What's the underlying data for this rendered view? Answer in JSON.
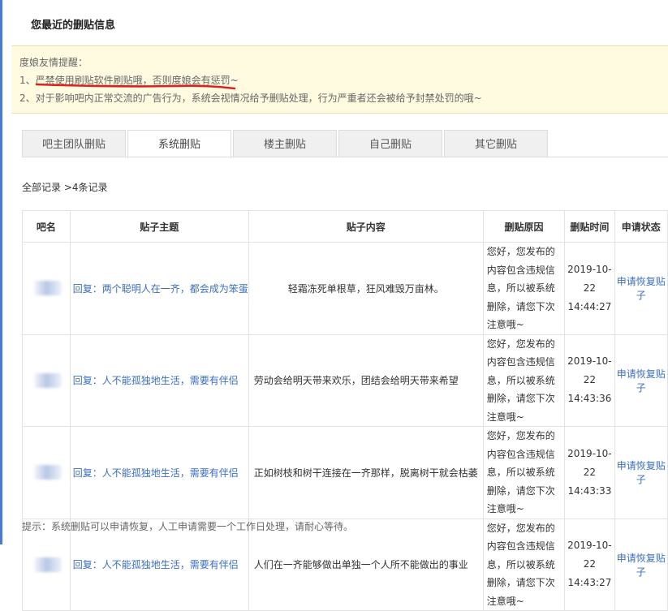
{
  "page": {
    "title": "您最近的删贴信息"
  },
  "notice": {
    "title": "度娘友情提醒：",
    "line1_prefix": "1、",
    "line1_warning": "严禁使用刷贴软件刷贴哦，否则度娘会有惩罚~",
    "line2": "2、对于影响吧内正常交流的广告行为，系统会视情况给予删贴处理，行为严重者还会被给予封禁处罚的哦~",
    "underline_color": "#e02020"
  },
  "tabs": [
    {
      "label": "吧主团队删贴",
      "active": false
    },
    {
      "label": "系统删贴",
      "active": true
    },
    {
      "label": "楼主删贴",
      "active": false
    },
    {
      "label": "自己删贴",
      "active": false
    },
    {
      "label": "其它删贴",
      "active": false
    }
  ],
  "summary": {
    "text": "全部记录 >4条记录"
  },
  "table": {
    "headers": {
      "name": "吧名",
      "topic": "贴子主题",
      "content": "贴子内容",
      "reason": "删贴原因",
      "time": "删贴时间",
      "status": "申请状态"
    },
    "rows": [
      {
        "topic": "回复：两个聪明人在一齐，都会成为笨蛋",
        "content": "轻霜冻死单根草，狂风难毁万亩林。",
        "reason": "您好，您发布的内容包含违规信息，所以被系统删除，请您下次注意哦~",
        "date": "2019-10-22",
        "clock": "14:44:27",
        "action": "申请恢复贴子"
      },
      {
        "topic": "回复：人不能孤独地生活，需要有伴侣",
        "content": "劳动会给明天带来欢乐，团结会给明天带来希望",
        "reason": "您好，您发布的内容包含违规信息，所以被系统删除，请您下次注意哦~",
        "date": "2019-10-22",
        "clock": "14:43:36",
        "action": "申请恢复贴子"
      },
      {
        "topic": "回复：人不能孤独地生活，需要有伴侣",
        "content": "正如树枝和树干连接在一齐那样，脱离树干就会枯萎",
        "reason": "您好，您发布的内容包含违规信息，所以被系统删除，请您下次注意哦~",
        "date": "2019-10-22",
        "clock": "14:43:33",
        "action": "申请恢复贴子"
      },
      {
        "topic": "回复：人不能孤独地生活，需要有伴侣",
        "content": "人们在一齐能够做出单独一个人所不能做出的事业",
        "reason": "您好，您发布的内容包含违规信息，所以被系统删除，请您下次注意哦~",
        "date": "2019-10-22",
        "clock": "14:43:27",
        "action": "申请恢复贴子"
      }
    ]
  },
  "footer": {
    "tip": "提示：系统删贴可以申请恢复，人工申请需要一个工作日处理，请耐心等待。"
  }
}
